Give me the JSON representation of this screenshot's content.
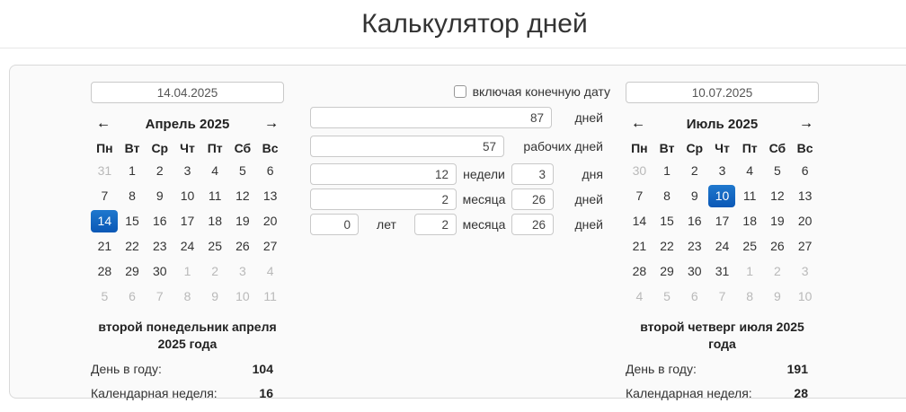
{
  "header": {
    "title": "Калькулятор дней"
  },
  "icons": {
    "prev_arrow": "←",
    "next_arrow": "→"
  },
  "colors": {
    "selected_day_top": "#1f78cd",
    "selected_day_bottom": "#0b58b6",
    "muted_day": "#b9b9b9"
  },
  "middle": {
    "include_end_date": {
      "label": "включая конечную дату",
      "checked": false
    },
    "days": {
      "value": "87",
      "unit": "дней"
    },
    "workdays": {
      "value": "57",
      "unit": "рабочих дней"
    },
    "weeks": {
      "value": "12",
      "unit": "недели",
      "value2": "3",
      "unit2": "дня"
    },
    "months": {
      "value": "2",
      "unit": "месяца",
      "value2": "26",
      "unit2": "дней"
    },
    "years": {
      "value": "0",
      "unit": "лет",
      "value2": "2",
      "unit2": "месяца",
      "value3": "26",
      "unit3": "дней"
    }
  },
  "start_calendar": {
    "input_value": "14.04.2025",
    "title": "Апрель 2025",
    "weekdays": [
      "Пн",
      "Вт",
      "Ср",
      "Чт",
      "Пт",
      "Сб",
      "Вс"
    ],
    "days": [
      {
        "d": "31",
        "m": 1
      },
      {
        "d": "1"
      },
      {
        "d": "2"
      },
      {
        "d": "3"
      },
      {
        "d": "4"
      },
      {
        "d": "5"
      },
      {
        "d": "6"
      },
      {
        "d": "7"
      },
      {
        "d": "8"
      },
      {
        "d": "9"
      },
      {
        "d": "10"
      },
      {
        "d": "11"
      },
      {
        "d": "12"
      },
      {
        "d": "13"
      },
      {
        "d": "14",
        "s": 1
      },
      {
        "d": "15"
      },
      {
        "d": "16"
      },
      {
        "d": "17"
      },
      {
        "d": "18"
      },
      {
        "d": "19"
      },
      {
        "d": "20"
      },
      {
        "d": "21"
      },
      {
        "d": "22"
      },
      {
        "d": "23"
      },
      {
        "d": "24"
      },
      {
        "d": "25"
      },
      {
        "d": "26"
      },
      {
        "d": "27"
      },
      {
        "d": "28"
      },
      {
        "d": "29"
      },
      {
        "d": "30"
      },
      {
        "d": "1",
        "m": 1
      },
      {
        "d": "2",
        "m": 1
      },
      {
        "d": "3",
        "m": 1
      },
      {
        "d": "4",
        "m": 1
      },
      {
        "d": "5",
        "m": 1
      },
      {
        "d": "6",
        "m": 1
      },
      {
        "d": "7",
        "m": 1
      },
      {
        "d": "8",
        "m": 1
      },
      {
        "d": "9",
        "m": 1
      },
      {
        "d": "10",
        "m": 1
      },
      {
        "d": "11",
        "m": 1
      }
    ],
    "caption": "второй понедельник апреля 2025 года",
    "stats": [
      {
        "label": "День в году:",
        "value": "104"
      },
      {
        "label": "Календарная неделя:",
        "value": "16"
      }
    ]
  },
  "end_calendar": {
    "input_value": "10.07.2025",
    "title": "Июль 2025",
    "weekdays": [
      "Пн",
      "Вт",
      "Ср",
      "Чт",
      "Пт",
      "Сб",
      "Вс"
    ],
    "days": [
      {
        "d": "30",
        "m": 1
      },
      {
        "d": "1"
      },
      {
        "d": "2"
      },
      {
        "d": "3"
      },
      {
        "d": "4"
      },
      {
        "d": "5"
      },
      {
        "d": "6"
      },
      {
        "d": "7"
      },
      {
        "d": "8"
      },
      {
        "d": "9"
      },
      {
        "d": "10",
        "s": 1
      },
      {
        "d": "11"
      },
      {
        "d": "12"
      },
      {
        "d": "13"
      },
      {
        "d": "14"
      },
      {
        "d": "15"
      },
      {
        "d": "16"
      },
      {
        "d": "17"
      },
      {
        "d": "18"
      },
      {
        "d": "19"
      },
      {
        "d": "20"
      },
      {
        "d": "21"
      },
      {
        "d": "22"
      },
      {
        "d": "23"
      },
      {
        "d": "24"
      },
      {
        "d": "25"
      },
      {
        "d": "26"
      },
      {
        "d": "27"
      },
      {
        "d": "28"
      },
      {
        "d": "29"
      },
      {
        "d": "30"
      },
      {
        "d": "31"
      },
      {
        "d": "1",
        "m": 1
      },
      {
        "d": "2",
        "m": 1
      },
      {
        "d": "3",
        "m": 1
      },
      {
        "d": "4",
        "m": 1
      },
      {
        "d": "5",
        "m": 1
      },
      {
        "d": "6",
        "m": 1
      },
      {
        "d": "7",
        "m": 1
      },
      {
        "d": "8",
        "m": 1
      },
      {
        "d": "9",
        "m": 1
      },
      {
        "d": "10",
        "m": 1
      }
    ],
    "caption": "второй четверг июля 2025 года",
    "stats": [
      {
        "label": "День в году:",
        "value": "191"
      },
      {
        "label": "Календарная неделя:",
        "value": "28"
      }
    ]
  }
}
